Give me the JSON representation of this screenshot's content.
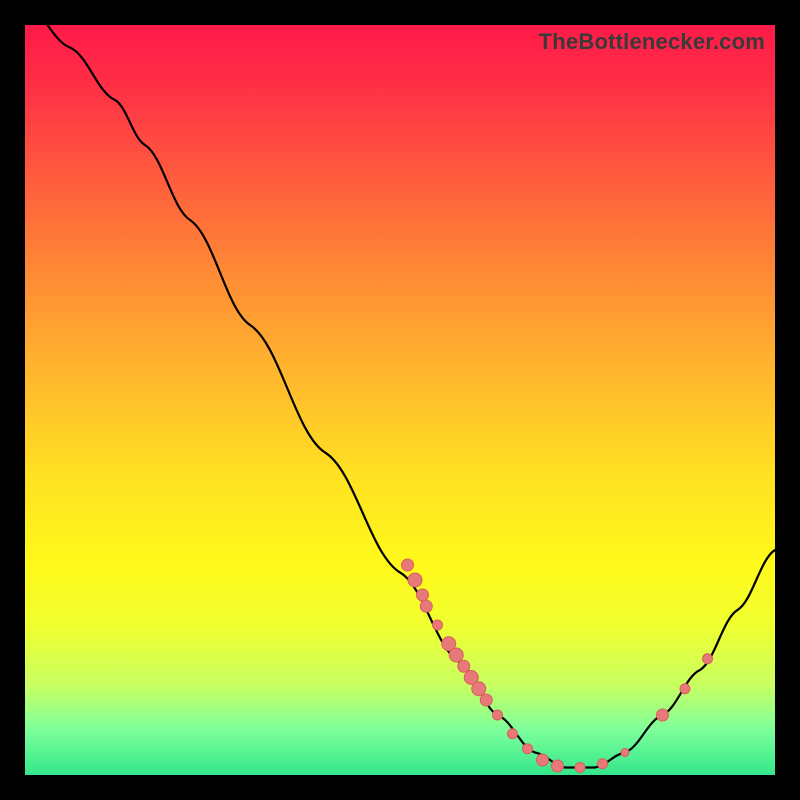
{
  "watermark": {
    "text": "TheBottlenecker.com"
  },
  "colors": {
    "dot": "#e77a78",
    "dot_stroke": "#d85f5d",
    "curve": "#000000"
  },
  "chart_data": {
    "type": "line",
    "title": "",
    "xlabel": "",
    "ylabel": "",
    "xlim": [
      0,
      100
    ],
    "ylim": [
      0,
      100
    ],
    "curve": [
      {
        "x": 0,
        "y": 103
      },
      {
        "x": 6,
        "y": 97
      },
      {
        "x": 12,
        "y": 90
      },
      {
        "x": 16,
        "y": 84
      },
      {
        "x": 22,
        "y": 74
      },
      {
        "x": 30,
        "y": 60
      },
      {
        "x": 40,
        "y": 43
      },
      {
        "x": 50,
        "y": 27
      },
      {
        "x": 58,
        "y": 15
      },
      {
        "x": 63,
        "y": 8
      },
      {
        "x": 68,
        "y": 3
      },
      {
        "x": 72,
        "y": 1
      },
      {
        "x": 76,
        "y": 1
      },
      {
        "x": 80,
        "y": 3
      },
      {
        "x": 85,
        "y": 8
      },
      {
        "x": 90,
        "y": 14
      },
      {
        "x": 95,
        "y": 22
      },
      {
        "x": 100,
        "y": 30
      }
    ],
    "points": [
      {
        "x": 51,
        "y": 28,
        "r": 6
      },
      {
        "x": 52,
        "y": 26,
        "r": 7
      },
      {
        "x": 53,
        "y": 24,
        "r": 6
      },
      {
        "x": 53.5,
        "y": 22.5,
        "r": 6
      },
      {
        "x": 55,
        "y": 20,
        "r": 5
      },
      {
        "x": 56.5,
        "y": 17.5,
        "r": 7
      },
      {
        "x": 57.5,
        "y": 16,
        "r": 7
      },
      {
        "x": 58.5,
        "y": 14.5,
        "r": 6
      },
      {
        "x": 59.5,
        "y": 13,
        "r": 7
      },
      {
        "x": 60.5,
        "y": 11.5,
        "r": 7
      },
      {
        "x": 61.5,
        "y": 10,
        "r": 6
      },
      {
        "x": 63,
        "y": 8,
        "r": 5
      },
      {
        "x": 65,
        "y": 5.5,
        "r": 5
      },
      {
        "x": 67,
        "y": 3.5,
        "r": 5
      },
      {
        "x": 69,
        "y": 2,
        "r": 6
      },
      {
        "x": 71,
        "y": 1.2,
        "r": 6
      },
      {
        "x": 74,
        "y": 1,
        "r": 5
      },
      {
        "x": 77,
        "y": 1.5,
        "r": 5
      },
      {
        "x": 80,
        "y": 3,
        "r": 4
      },
      {
        "x": 85,
        "y": 8,
        "r": 6
      },
      {
        "x": 88,
        "y": 11.5,
        "r": 5
      },
      {
        "x": 91,
        "y": 15.5,
        "r": 5
      }
    ]
  }
}
